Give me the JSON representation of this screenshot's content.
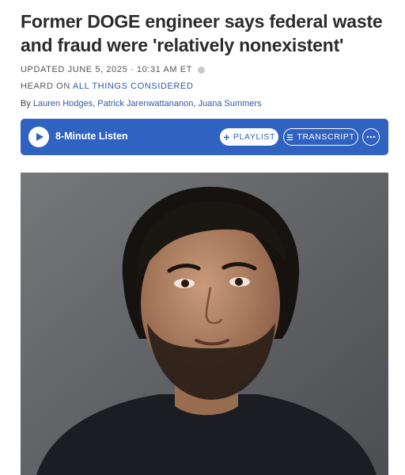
{
  "article": {
    "headline": "Former DOGE engineer says federal waste and fraud were 'relatively nonexistent'",
    "updated": "UPDATED JUNE 5, 2025 · 10:31 AM ET",
    "heard_prefix": "HEARD ON",
    "heard_program": "ALL THINGS CONSIDERED",
    "byline_prefix": "By",
    "authors": [
      "Lauren Hodges",
      "Patrick Jarenwattananon",
      "Juana Summers"
    ]
  },
  "player": {
    "listen_label": "8-Minute Listen",
    "playlist_label": "PLAYLIST",
    "transcript_label": "TRANSCRIPT",
    "accent_color": "#2f62c1"
  },
  "icons": {
    "play": "play-icon",
    "plus": "plus-icon",
    "transcript": "lines-icon",
    "more": "ellipsis-icon",
    "info": "info-icon"
  }
}
